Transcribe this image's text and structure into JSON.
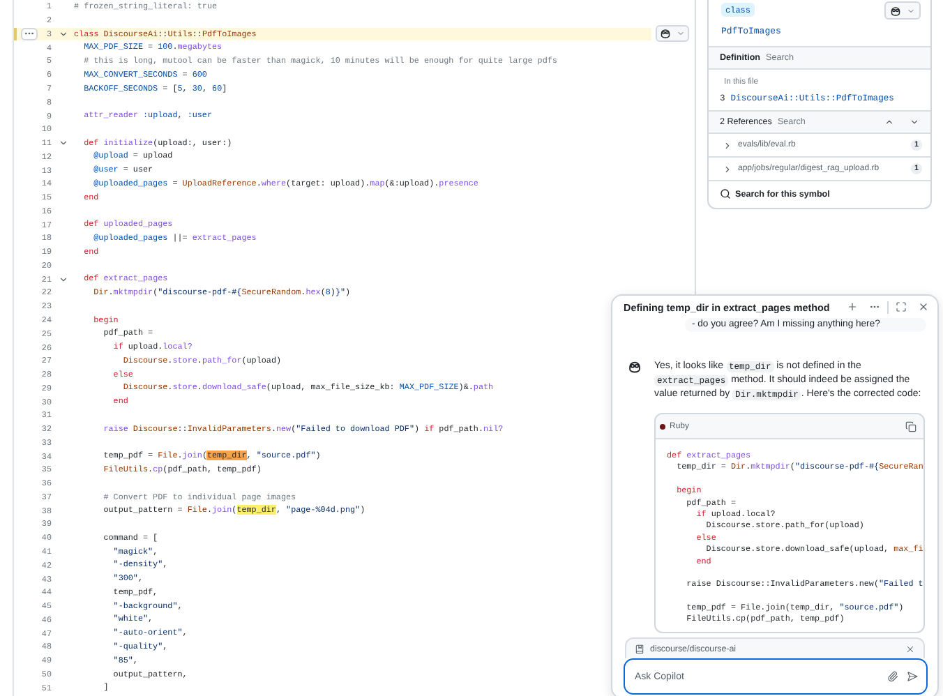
{
  "editor": {
    "lines": [
      {
        "number": "1",
        "selected": false,
        "fold": false,
        "tokens": [
          {
            "text": "# frozen_string_literal: true",
            "kind": "c"
          }
        ]
      },
      {
        "number": "2",
        "selected": false,
        "fold": false
      },
      {
        "number": "3",
        "selected": true,
        "fold": true,
        "tokens": [
          {
            "text": "class ",
            "kind": "k"
          },
          {
            "text": "DiscourseAi",
            "kind": "e"
          },
          {
            "text": "::",
            "kind": "p"
          },
          {
            "text": "Utils",
            "kind": "e"
          },
          {
            "text": "::",
            "kind": "p"
          },
          {
            "text": "PdfToImages",
            "kind": "e"
          }
        ]
      },
      {
        "number": "4",
        "selected": false,
        "fold": false,
        "tokens": [
          {
            "text": "  MAX_PDF_SIZE",
            "kind": "t"
          },
          {
            "text": " = ",
            "kind": "p"
          },
          {
            "text": "100",
            "kind": "n"
          },
          {
            "text": ".",
            "kind": "p"
          },
          {
            "text": "megabytes",
            "kind": "f"
          }
        ]
      },
      {
        "number": "5",
        "selected": false,
        "fold": false,
        "tokens": [
          {
            "text": "  # this is long, mutool can be faster than magick, 10 minutes will be enough for quite large pdfs",
            "kind": "c"
          }
        ]
      },
      {
        "number": "6",
        "selected": false,
        "fold": false,
        "tokens": [
          {
            "text": "  MAX_CONVERT_SECONDS",
            "kind": "t"
          },
          {
            "text": " = ",
            "kind": "p"
          },
          {
            "text": "600",
            "kind": "n"
          }
        ]
      },
      {
        "number": "7",
        "selected": false,
        "fold": false,
        "tokens": [
          {
            "text": "  BACKOFF_SECONDS",
            "kind": "t"
          },
          {
            "text": " = [",
            "kind": "p"
          },
          {
            "text": "5",
            "kind": "n"
          },
          {
            "text": ", ",
            "kind": "p"
          },
          {
            "text": "30",
            "kind": "n"
          },
          {
            "text": ", ",
            "kind": "p"
          },
          {
            "text": "60",
            "kind": "n"
          },
          {
            "text": "]",
            "kind": "p"
          }
        ]
      },
      {
        "number": "8",
        "selected": false,
        "fold": false
      },
      {
        "number": "9",
        "selected": false,
        "fold": false,
        "tokens": [
          {
            "text": "  attr_reader",
            "kind": "f"
          },
          {
            "text": " :upload",
            "kind": "y"
          },
          {
            "text": ",",
            "kind": "p"
          },
          {
            "text": " :user",
            "kind": "y"
          }
        ]
      },
      {
        "number": "10",
        "selected": false,
        "fold": false
      },
      {
        "number": "11",
        "selected": false,
        "fold": true,
        "tokens": [
          {
            "text": "  def ",
            "kind": "k"
          },
          {
            "text": "initialize",
            "kind": "f"
          },
          {
            "text": "(upload:, user:)",
            "kind": "p"
          }
        ]
      },
      {
        "number": "12",
        "selected": false,
        "fold": false,
        "tokens": [
          {
            "text": "    @upload",
            "kind": "v"
          },
          {
            "text": " = upload",
            "kind": "p"
          }
        ]
      },
      {
        "number": "13",
        "selected": false,
        "fold": false,
        "tokens": [
          {
            "text": "    @user",
            "kind": "v"
          },
          {
            "text": " = user",
            "kind": "p"
          }
        ]
      },
      {
        "number": "14",
        "selected": false,
        "fold": false,
        "tokens": [
          {
            "text": "    @uploaded_pages",
            "kind": "v"
          },
          {
            "text": " = ",
            "kind": "p"
          },
          {
            "text": "UploadReference",
            "kind": "e"
          },
          {
            "text": ".",
            "kind": "p"
          },
          {
            "text": "where",
            "kind": "f"
          },
          {
            "text": "(target: upload).",
            "kind": "p"
          },
          {
            "text": "map",
            "kind": "f"
          },
          {
            "text": "(&:upload).",
            "kind": "p"
          },
          {
            "text": "presence",
            "kind": "f"
          }
        ]
      },
      {
        "number": "15",
        "selected": false,
        "fold": false,
        "tokens": [
          {
            "text": "  end",
            "kind": "k"
          }
        ]
      },
      {
        "number": "16",
        "selected": false,
        "fold": false
      },
      {
        "number": "17",
        "selected": false,
        "fold": false,
        "tokens": [
          {
            "text": "  def ",
            "kind": "k"
          },
          {
            "text": "uploaded_pages",
            "kind": "f"
          }
        ]
      },
      {
        "number": "18",
        "selected": false,
        "fold": false,
        "tokens": [
          {
            "text": "    @uploaded_pages",
            "kind": "v"
          },
          {
            "text": " ||= ",
            "kind": "p"
          },
          {
            "text": "extract_pages",
            "kind": "f"
          }
        ]
      },
      {
        "number": "19",
        "selected": false,
        "fold": false,
        "tokens": [
          {
            "text": "  end",
            "kind": "k"
          }
        ]
      },
      {
        "number": "20",
        "selected": false,
        "fold": false
      },
      {
        "number": "21",
        "selected": false,
        "fold": true,
        "tokens": [
          {
            "text": "  def ",
            "kind": "k"
          },
          {
            "text": "extract_pages",
            "kind": "f"
          }
        ]
      },
      {
        "number": "22",
        "selected": false,
        "fold": false,
        "tokens": [
          {
            "text": "    Dir",
            "kind": "e"
          },
          {
            "text": ".",
            "kind": "p"
          },
          {
            "text": "mktmpdir",
            "kind": "f"
          },
          {
            "text": "(",
            "kind": "p"
          },
          {
            "text": "\"discourse-pdf-#{",
            "kind": "s"
          },
          {
            "text": "SecureRandom",
            "kind": "e"
          },
          {
            "text": ".",
            "kind": "p"
          },
          {
            "text": "hex",
            "kind": "f"
          },
          {
            "text": "(",
            "kind": "p"
          },
          {
            "text": "8",
            "kind": "n"
          },
          {
            "text": ")",
            "kind": "p"
          },
          {
            "text": "}\"",
            "kind": "s"
          },
          {
            "text": ")",
            "kind": "p"
          }
        ]
      },
      {
        "number": "23",
        "selected": false,
        "fold": false
      },
      {
        "number": "24",
        "selected": false,
        "fold": false,
        "tokens": [
          {
            "text": "    begin",
            "kind": "k"
          }
        ]
      },
      {
        "number": "25",
        "selected": false,
        "fold": false,
        "tokens": [
          {
            "text": "      pdf_path =",
            "kind": "p"
          }
        ]
      },
      {
        "number": "26",
        "selected": false,
        "fold": false,
        "tokens": [
          {
            "text": "        if ",
            "kind": "k"
          },
          {
            "text": "upload.",
            "kind": "p"
          },
          {
            "text": "local?",
            "kind": "f"
          }
        ]
      },
      {
        "number": "27",
        "selected": false,
        "fold": false,
        "tokens": [
          {
            "text": "          Discourse",
            "kind": "e"
          },
          {
            "text": ".",
            "kind": "p"
          },
          {
            "text": "store",
            "kind": "f"
          },
          {
            "text": ".",
            "kind": "p"
          },
          {
            "text": "path_for",
            "kind": "f"
          },
          {
            "text": "(upload)",
            "kind": "p"
          }
        ]
      },
      {
        "number": "28",
        "selected": false,
        "fold": false,
        "tokens": [
          {
            "text": "        else",
            "kind": "k"
          }
        ]
      },
      {
        "number": "29",
        "selected": false,
        "fold": false,
        "tokens": [
          {
            "text": "          Discourse",
            "kind": "e"
          },
          {
            "text": ".",
            "kind": "p"
          },
          {
            "text": "store",
            "kind": "f"
          },
          {
            "text": ".",
            "kind": "p"
          },
          {
            "text": "download_safe",
            "kind": "f"
          },
          {
            "text": "(upload, max_file_size_kb: ",
            "kind": "p"
          },
          {
            "text": "MAX_PDF_SIZE",
            "kind": "t"
          },
          {
            "text": ")&.",
            "kind": "p"
          },
          {
            "text": "path",
            "kind": "f"
          }
        ]
      },
      {
        "number": "30",
        "selected": false,
        "fold": false,
        "tokens": [
          {
            "text": "        end",
            "kind": "k"
          }
        ]
      },
      {
        "number": "31",
        "selected": false,
        "fold": false
      },
      {
        "number": "32",
        "selected": false,
        "fold": false,
        "tokens": [
          {
            "text": "      raise ",
            "kind": "f"
          },
          {
            "text": "Discourse",
            "kind": "e"
          },
          {
            "text": "::",
            "kind": "p"
          },
          {
            "text": "InvalidParameters",
            "kind": "e"
          },
          {
            "text": ".",
            "kind": "p"
          },
          {
            "text": "new",
            "kind": "f"
          },
          {
            "text": "(",
            "kind": "p"
          },
          {
            "text": "\"Failed to download PDF\"",
            "kind": "s"
          },
          {
            "text": ") ",
            "kind": "p"
          },
          {
            "text": "if ",
            "kind": "k"
          },
          {
            "text": "pdf_path.",
            "kind": "p"
          },
          {
            "text": "nil?",
            "kind": "f"
          }
        ]
      },
      {
        "number": "33",
        "selected": false,
        "fold": false
      },
      {
        "number": "34",
        "selected": false,
        "fold": false,
        "tokens": [
          {
            "text": "      temp_pdf = ",
            "kind": "p"
          },
          {
            "text": "File",
            "kind": "e"
          },
          {
            "text": ".",
            "kind": "p"
          },
          {
            "text": "join",
            "kind": "f"
          },
          {
            "text": "(",
            "kind": "p"
          },
          {
            "text": "temp_dir",
            "kind": "p",
            "match": true,
            "current": true
          },
          {
            "text": ", ",
            "kind": "p"
          },
          {
            "text": "\"source.pdf\"",
            "kind": "s"
          },
          {
            "text": ")",
            "kind": "p"
          }
        ]
      },
      {
        "number": "35",
        "selected": false,
        "fold": false,
        "tokens": [
          {
            "text": "      FileUtils",
            "kind": "e"
          },
          {
            "text": ".",
            "kind": "p"
          },
          {
            "text": "cp",
            "kind": "f"
          },
          {
            "text": "(pdf_path, temp_pdf)",
            "kind": "p"
          }
        ]
      },
      {
        "number": "36",
        "selected": false,
        "fold": false
      },
      {
        "number": "37",
        "selected": false,
        "fold": false,
        "tokens": [
          {
            "text": "      # Convert PDF to individual page images",
            "kind": "c"
          }
        ]
      },
      {
        "number": "38",
        "selected": false,
        "fold": false,
        "tokens": [
          {
            "text": "      output_pattern = ",
            "kind": "p"
          },
          {
            "text": "File",
            "kind": "e"
          },
          {
            "text": ".",
            "kind": "p"
          },
          {
            "text": "join",
            "kind": "f"
          },
          {
            "text": "(",
            "kind": "p"
          },
          {
            "text": "temp_dir",
            "kind": "p",
            "match": true,
            "current": false
          },
          {
            "text": ", ",
            "kind": "p"
          },
          {
            "text": "\"page-%04d.png\"",
            "kind": "s"
          },
          {
            "text": ")",
            "kind": "p"
          }
        ]
      },
      {
        "number": "39",
        "selected": false,
        "fold": false
      },
      {
        "number": "40",
        "selected": false,
        "fold": false,
        "tokens": [
          {
            "text": "      command = [",
            "kind": "p"
          }
        ]
      },
      {
        "number": "41",
        "selected": false,
        "fold": false,
        "tokens": [
          {
            "text": "        \"magick\"",
            "kind": "s"
          },
          {
            "text": ",",
            "kind": "p"
          }
        ]
      },
      {
        "number": "42",
        "selected": false,
        "fold": false,
        "tokens": [
          {
            "text": "        \"-density\"",
            "kind": "s"
          },
          {
            "text": ",",
            "kind": "p"
          }
        ]
      },
      {
        "number": "43",
        "selected": false,
        "fold": false,
        "tokens": [
          {
            "text": "        \"300\"",
            "kind": "s"
          },
          {
            "text": ",",
            "kind": "p"
          }
        ]
      },
      {
        "number": "44",
        "selected": false,
        "fold": false,
        "tokens": [
          {
            "text": "        temp_pdf,",
            "kind": "p"
          }
        ]
      },
      {
        "number": "45",
        "selected": false,
        "fold": false,
        "tokens": [
          {
            "text": "        \"-background\"",
            "kind": "s"
          },
          {
            "text": ",",
            "kind": "p"
          }
        ]
      },
      {
        "number": "46",
        "selected": false,
        "fold": false,
        "tokens": [
          {
            "text": "        \"white\"",
            "kind": "s"
          },
          {
            "text": ",",
            "kind": "p"
          }
        ]
      },
      {
        "number": "47",
        "selected": false,
        "fold": false,
        "tokens": [
          {
            "text": "        \"-auto-orient\"",
            "kind": "s"
          },
          {
            "text": ",",
            "kind": "p"
          }
        ]
      },
      {
        "number": "48",
        "selected": false,
        "fold": false,
        "tokens": [
          {
            "text": "        \"-quality\"",
            "kind": "s"
          },
          {
            "text": ",",
            "kind": "p"
          }
        ]
      },
      {
        "number": "49",
        "selected": false,
        "fold": false,
        "tokens": [
          {
            "text": "        \"85\"",
            "kind": "s"
          },
          {
            "text": ",",
            "kind": "p"
          }
        ]
      },
      {
        "number": "50",
        "selected": false,
        "fold": false,
        "tokens": [
          {
            "text": "        output_pattern,",
            "kind": "p"
          }
        ]
      },
      {
        "number": "51",
        "selected": false,
        "fold": false,
        "tokens": [
          {
            "text": "      ]",
            "kind": "p"
          }
        ]
      }
    ]
  },
  "symbol_panel": {
    "badge": "class",
    "name": "PdfToImages",
    "definition_tab": "Definition",
    "definition_search": "Search",
    "section": "In this file",
    "definition": {
      "line": "3",
      "symbol": "DiscourseAi::Utils::PdfToImages"
    },
    "references_title": "2 References",
    "references_search": "Search",
    "references": [
      {
        "path": "evals/lib/eval.rb",
        "count": "1",
        "expanded": false
      },
      {
        "path": "app/jobs/regular/digest_rag_upload.rb",
        "count": "1",
        "expanded": false
      }
    ],
    "search_link": "Search for this symbol"
  },
  "chat": {
    "title": "Defining temp_dir in extract_pages method",
    "user_message": "- do you agree?  Am I missing anything here?",
    "reply": [
      {
        "text": "Yes, it looks like ",
        "kind": "text"
      },
      {
        "text": "temp_dir",
        "kind": "code"
      },
      {
        "text": " is not defined in the ",
        "kind": "text"
      },
      {
        "text": "extract_pages",
        "kind": "code"
      },
      {
        "text": " method. It should indeed be assigned the value returned by ",
        "kind": "text"
      },
      {
        "text": "Dir.mktmpdir",
        "kind": "code"
      },
      {
        "text": ". Here's the corrected code:",
        "kind": "text"
      }
    ],
    "code_block": {
      "language": "Ruby",
      "lines": [
        {
          "kind": "code",
          "tokens": [
            {
              "text": "def ",
              "kind": "k"
            },
            {
              "text": "extract_pages",
              "kind": "f"
            }
          ]
        },
        {
          "kind": "code",
          "tokens": [
            {
              "text": "  temp_dir = ",
              "kind": "p"
            },
            {
              "text": "Dir",
              "kind": "e"
            },
            {
              "text": ".",
              "kind": "p"
            },
            {
              "text": "mktmpdir",
              "kind": "f"
            },
            {
              "text": "(",
              "kind": "p"
            },
            {
              "text": "\"discourse-pdf-#{",
              "kind": "s"
            },
            {
              "text": "SecureRan",
              "kind": "e"
            }
          ]
        },
        {
          "kind": "blank"
        },
        {
          "kind": "code",
          "tokens": [
            {
              "text": "  begin",
              "kind": "k"
            }
          ]
        },
        {
          "kind": "code",
          "tokens": [
            {
              "text": "    pdf_path =",
              "kind": "p"
            }
          ]
        },
        {
          "kind": "code",
          "tokens": [
            {
              "text": "      if ",
              "kind": "k"
            },
            {
              "text": "upload.local?",
              "kind": "p"
            }
          ]
        },
        {
          "kind": "code",
          "tokens": [
            {
              "text": "        Discourse.store.path_for(upload)",
              "kind": "p"
            }
          ]
        },
        {
          "kind": "code",
          "tokens": [
            {
              "text": "      else",
              "kind": "k"
            }
          ]
        },
        {
          "kind": "code",
          "tokens": [
            {
              "text": "        Discourse.store.download_safe(upload, ",
              "kind": "p"
            },
            {
              "text": "max_fi",
              "kind": "e"
            }
          ]
        },
        {
          "kind": "code",
          "tokens": [
            {
              "text": "      end",
              "kind": "k"
            }
          ]
        },
        {
          "kind": "blank"
        },
        {
          "kind": "code",
          "tokens": [
            {
              "text": "    raise Discourse::InvalidParameters.new(",
              "kind": "p"
            },
            {
              "text": "\"Failed t",
              "kind": "s"
            }
          ]
        },
        {
          "kind": "blank"
        },
        {
          "kind": "code",
          "tokens": [
            {
              "text": "    temp_pdf = File.join(temp_dir, ",
              "kind": "p"
            },
            {
              "text": "\"source.pdf\"",
              "kind": "s"
            },
            {
              "text": ")",
              "kind": "p"
            }
          ]
        },
        {
          "kind": "code",
          "tokens": [
            {
              "text": "    FileUtils.cp(pdf_path, temp_pdf)",
              "kind": "p"
            }
          ]
        }
      ]
    },
    "repository": "discourse/discourse-ai",
    "input": {
      "placeholder": "Ask Copilot"
    }
  }
}
